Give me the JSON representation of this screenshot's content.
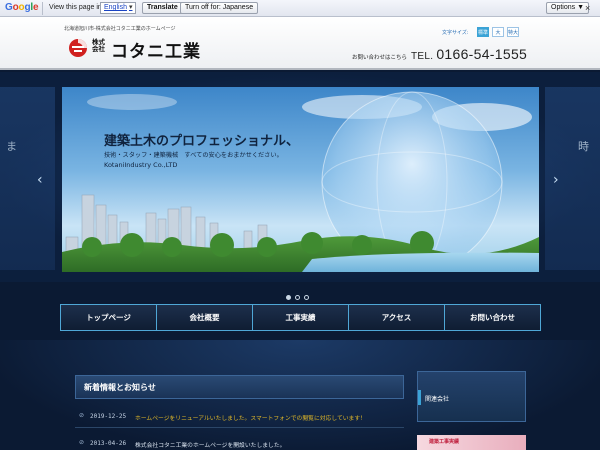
{
  "translate_bar": {
    "brand": "Google",
    "view_label": "View this page in:",
    "language": "English",
    "translate_label": "Translate",
    "turnoff_label": "Turn off for: Japanese",
    "options_label": "Options ▼",
    "close_glyph": "×"
  },
  "header": {
    "tagline": "北海道旭川市-株式会社コタニ工業のホームページ",
    "logo_small": "株式会社",
    "logo_main": "コタニ工業",
    "font_size_label": "文字サイズ:",
    "font_sizes": [
      "標準",
      "大",
      "特大"
    ],
    "contact_label": "お問い合わせはこちら",
    "tel_prefix": "TEL.",
    "tel_number": "0166-54-1555"
  },
  "slider": {
    "title": "建築土木のプロフェッショナル、",
    "subtitle": "技術・スタッフ・建築機械　すべての安心をおまかせください。",
    "company": "KotaniIndustry Co.,LTD",
    "ghost_left": "ま",
    "ghost_right": "時",
    "prev_glyph": "‹",
    "next_glyph": "›",
    "dot_count": 3,
    "active_dot": 0
  },
  "nav": {
    "items": [
      "トップページ",
      "会社概要",
      "工事実績",
      "アクセス",
      "お問い合わせ"
    ]
  },
  "news": {
    "heading": "新着情報とお知らせ",
    "items": [
      {
        "date": "2019-12-25",
        "text": "ホームページをリニューアルいたしました。スマートフォンでの閲覧に対応しています！",
        "color": "#e2b928"
      },
      {
        "date": "2013-04-26",
        "text": "株式会社コタニ工業のホームページを開設いたしました。",
        "color": "#d8e2ee"
      }
    ]
  },
  "sidebar": {
    "label": "関連会社",
    "banner_text": "建築工事実績"
  },
  "colors": {
    "accent": "#3ba3d6",
    "logo_red": "#d0201f",
    "navy": "#0b1a33"
  }
}
